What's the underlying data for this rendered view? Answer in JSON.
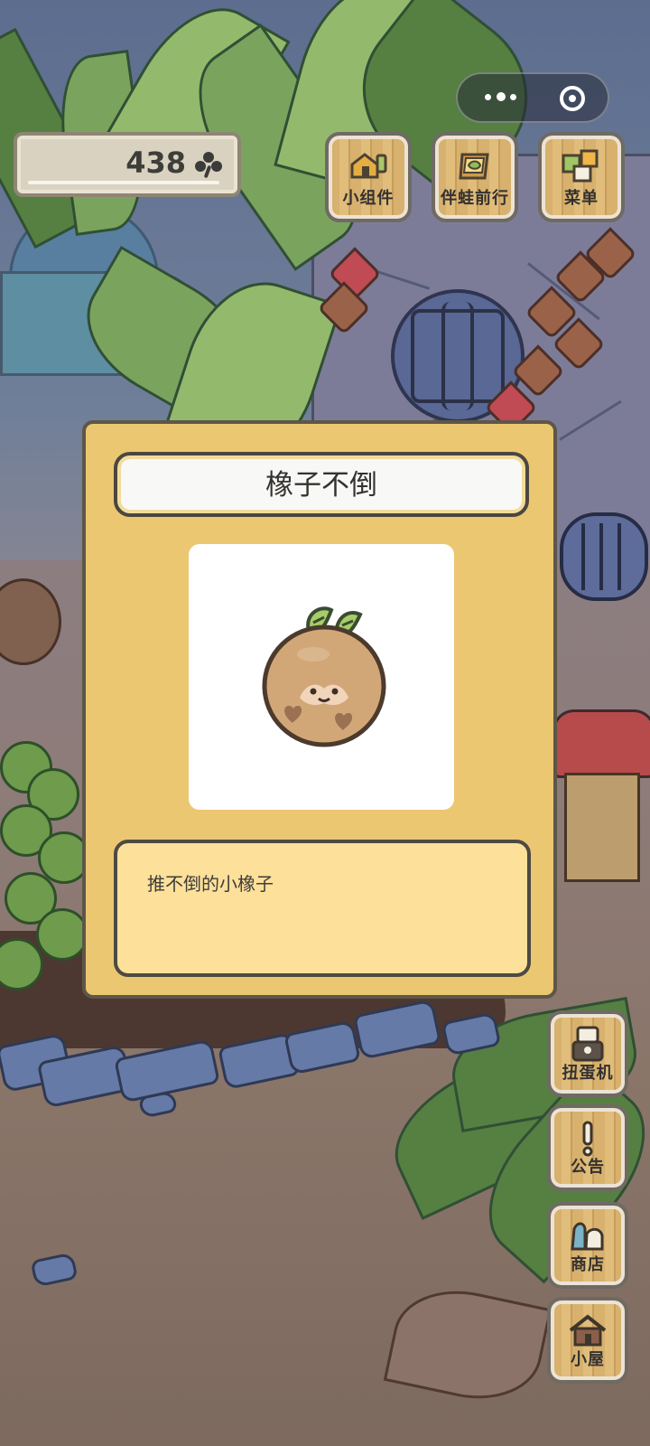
{
  "currency": {
    "value": "438",
    "icon": "clover-icon"
  },
  "system_controls": {
    "more_icon": "more-icon",
    "close_icon": "close-icon"
  },
  "top_buttons": [
    {
      "label": "小组件",
      "icon": "widget-icon"
    },
    {
      "label": "伴蛙前行",
      "icon": "frog-journey-icon"
    },
    {
      "label": "菜单",
      "icon": "menu-icon"
    }
  ],
  "side_buttons": [
    {
      "label": "扭蛋机",
      "icon": "gacha-machine-icon"
    },
    {
      "label": "公告",
      "icon": "announcement-icon"
    },
    {
      "label": "商店",
      "icon": "shop-icon"
    },
    {
      "label": "小屋",
      "icon": "house-icon"
    }
  ],
  "modal": {
    "title": "橡子不倒",
    "description": "推不倒的小橡子",
    "item_icon": "acorn-icon"
  },
  "colors": {
    "modal_bg": "#ebc772",
    "title_box": "#f8f8f6",
    "desc_box": "#fde09a",
    "wood_button": "#d7b16d"
  }
}
